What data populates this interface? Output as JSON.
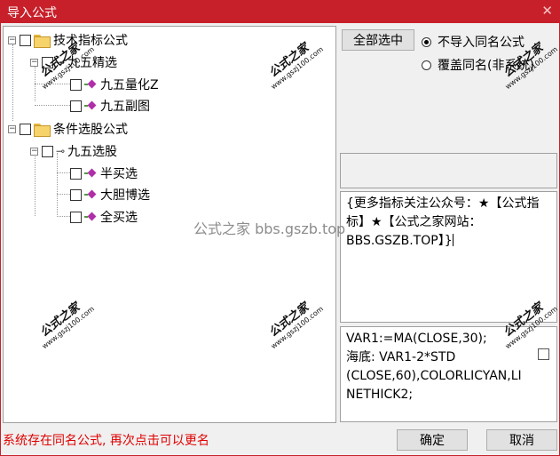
{
  "window": {
    "title": "导入公式",
    "close_glyph": "✕"
  },
  "tree": {
    "nodes": [
      {
        "label": "技术指标公式",
        "type": "folder"
      },
      {
        "label": "九五精选",
        "type": "key"
      },
      {
        "label": "九五量化Z",
        "type": "formula"
      },
      {
        "label": "九五副图",
        "type": "formula"
      },
      {
        "label": "条件选股公式",
        "type": "folder"
      },
      {
        "label": "九五选股",
        "type": "key"
      },
      {
        "label": "半买选",
        "type": "formula"
      },
      {
        "label": "大胆博选",
        "type": "formula"
      },
      {
        "label": "全买选",
        "type": "formula"
      }
    ],
    "expander_minus": "−",
    "key_glyph": "⊸"
  },
  "buttons": {
    "select_all": "全部选中",
    "ok": "确定",
    "cancel": "取消"
  },
  "options": {
    "no_import_same": "不导入同名公式",
    "overwrite_same": "覆盖同名(非系统)",
    "selected": "no_import_same"
  },
  "description": {
    "text": "{更多指标关注公众号：★【公式指标】★【公式之家网站：BBS.GSZB.TOP】}"
  },
  "code": {
    "line1": "VAR1:=MA(CLOSE,30);",
    "line2": "海底: VAR1-2*STD",
    "line3": "(CLOSE,60),COLORLICYAN,LI",
    "line4": "NETHICK2;"
  },
  "status": {
    "message": "系统存在同名公式, 再次点击可以更名"
  },
  "watermarks": {
    "brand": "公式之家",
    "url": "www.gszj100.com",
    "center": "公式之家 bbs.gszb.top"
  }
}
